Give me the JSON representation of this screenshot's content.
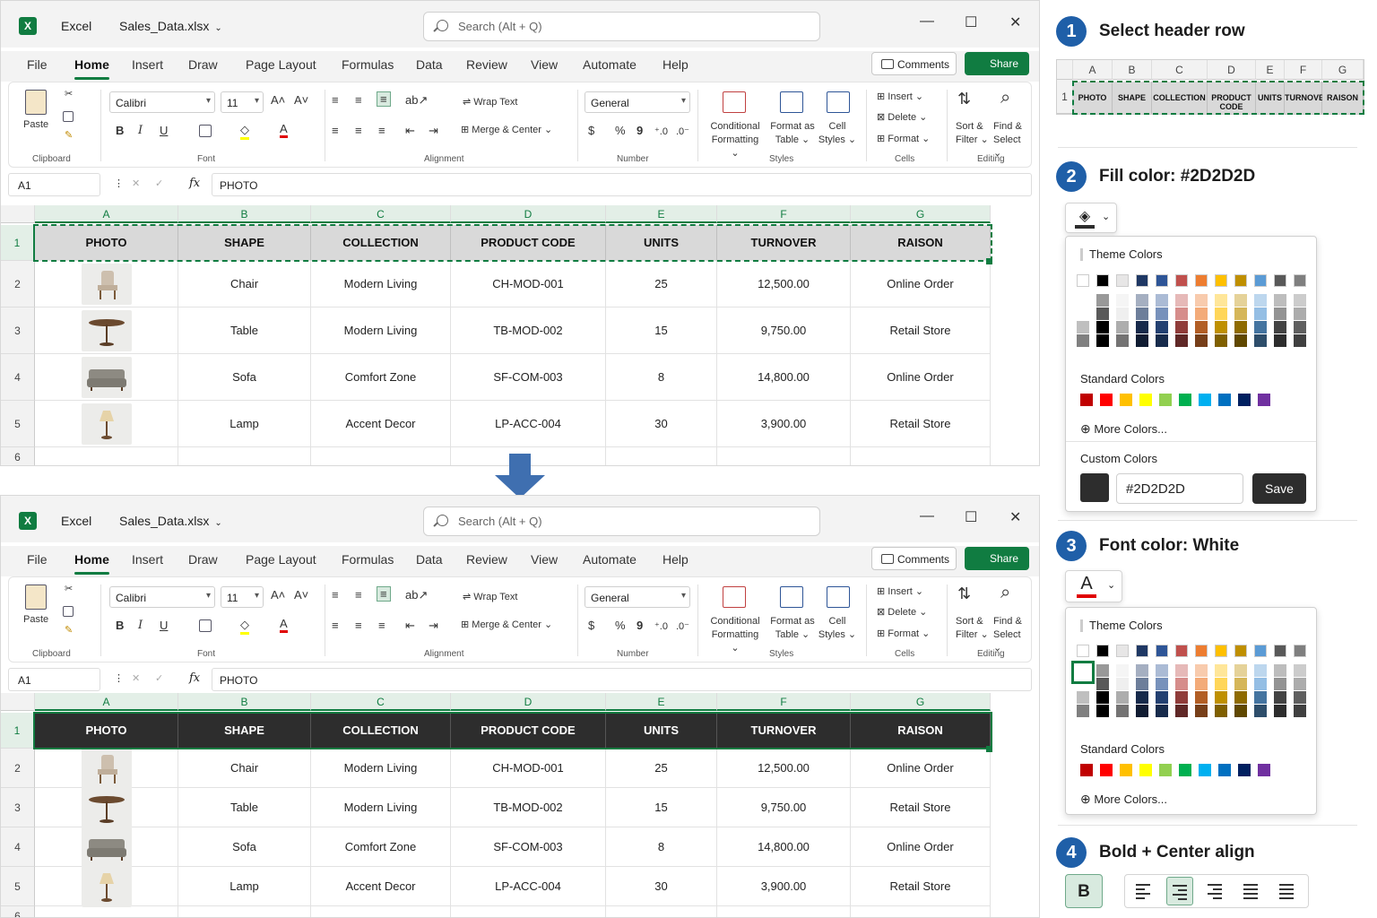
{
  "window": {
    "app_name": "Excel",
    "file_name": "Sales_Data.xlsx",
    "search_placeholder": "Search (Alt + Q)",
    "controls": {
      "minimize": "—",
      "maximize": "☐",
      "close": "✕"
    }
  },
  "menu": {
    "tabs": [
      "File",
      "Home",
      "Insert",
      "Draw",
      "Page Layout",
      "Formulas",
      "Data",
      "Review",
      "View",
      "Automate",
      "Help"
    ],
    "active_tab": "Home",
    "comments_label": "Comments",
    "share_label": "Share"
  },
  "ribbon": {
    "clipboard": {
      "paste": "Paste",
      "group": "Clipboard"
    },
    "font": {
      "name": "Calibri",
      "size": "11",
      "group": "Font",
      "bold": "B",
      "italic": "I",
      "underline": "U"
    },
    "alignment": {
      "wrap": "Wrap Text",
      "merge": "Merge & Center",
      "group": "Alignment"
    },
    "number": {
      "format": "General",
      "group": "Number",
      "currency": "$",
      "percent": "%",
      "comma": "9"
    },
    "styles": {
      "conditional": "Conditional",
      "conditional2": "Formatting",
      "format_as": "Format as",
      "format_as2": "Table",
      "cell": "Cell",
      "cell2": "Styles",
      "group": "Styles"
    },
    "cells": {
      "insert": "Insert",
      "delete": "Delete",
      "format": "Format",
      "group": "Cells"
    },
    "editing": {
      "sort": "Sort &",
      "sort2": "Filter",
      "find": "Find &",
      "find2": "Select",
      "group": "Editing"
    }
  },
  "formula_bar": {
    "name_box": "A1",
    "fx": "fx",
    "value": "PHOTO"
  },
  "sheet": {
    "columns": [
      "A",
      "B",
      "C",
      "D",
      "E",
      "F",
      "G"
    ],
    "headers": [
      "PHOTO",
      "SHAPE",
      "COLLECTION",
      "PRODUCT CODE",
      "UNITS",
      "TURNOVER",
      "RAISON"
    ],
    "rows": [
      {
        "num": "2",
        "photo": "chair",
        "shape": "Chair",
        "collection": "Modern Living",
        "code": "CH-MOD-001",
        "units": "25",
        "turnover": "12,500.00",
        "raison": "Online Order"
      },
      {
        "num": "3",
        "photo": "table",
        "shape": "Table",
        "collection": "Modern Living",
        "code": "TB-MOD-002",
        "units": "15",
        "turnover": "9,750.00",
        "raison": "Retail Store"
      },
      {
        "num": "4",
        "photo": "sofa",
        "shape": "Sofa",
        "collection": "Comfort Zone",
        "code": "SF-COM-003",
        "units": "8",
        "turnover": "14,800.00",
        "raison": "Online Order"
      },
      {
        "num": "5",
        "photo": "lamp",
        "shape": "Lamp",
        "collection": "Accent Decor",
        "code": "LP-ACC-004",
        "units": "30",
        "turnover": "3,900.00",
        "raison": "Retail Store"
      }
    ],
    "row_numbers": [
      "1",
      "2",
      "3",
      "4",
      "5",
      "6"
    ]
  },
  "steps": [
    {
      "num": "1",
      "title": "Select header row"
    },
    {
      "num": "2",
      "title": "Fill color: #2D2D2D"
    },
    {
      "num": "3",
      "title": "Font color: White"
    },
    {
      "num": "4",
      "title": "Bold + Center align"
    }
  ],
  "mini_sheet": {
    "row": "1",
    "headers": [
      "PHOTO",
      "SHAPE",
      "COLLECTION",
      "PRODUCT CODE",
      "UNITS",
      "TURNOVER",
      "RAISON"
    ]
  },
  "fill_picker": {
    "theme_label": "Theme Colors",
    "standard_label": "Standard Colors",
    "more_label": "More Colors...",
    "custom_label": "Custom Colors",
    "hex_value": "#2D2D2D",
    "save_label": "Save"
  },
  "font_picker": {
    "theme_label": "Theme Colors",
    "standard_label": "Standard Colors",
    "more_label": "More Colors...",
    "icon_letter": "A"
  },
  "format_buttons": {
    "bold": "B"
  },
  "colors": {
    "accent": "#107c41",
    "step_badge": "#1f5fa8",
    "header_fill_before": "#d9d9d9",
    "header_fill_after": "#2D2D2D",
    "theme_top": [
      "#ffffff",
      "#000000",
      "#e7e6e6",
      "#1f3864",
      "#2e5597",
      "#c0504d",
      "#ed7d31",
      "#ffc000",
      "#bf8f00",
      "#5b9bd5",
      "#595959",
      "#7f7f7f"
    ],
    "standard": [
      "#c00000",
      "#ff0000",
      "#ffc000",
      "#ffff00",
      "#92d050",
      "#00b050",
      "#00b0f0",
      "#0070c0",
      "#002060",
      "#7030a0"
    ]
  }
}
